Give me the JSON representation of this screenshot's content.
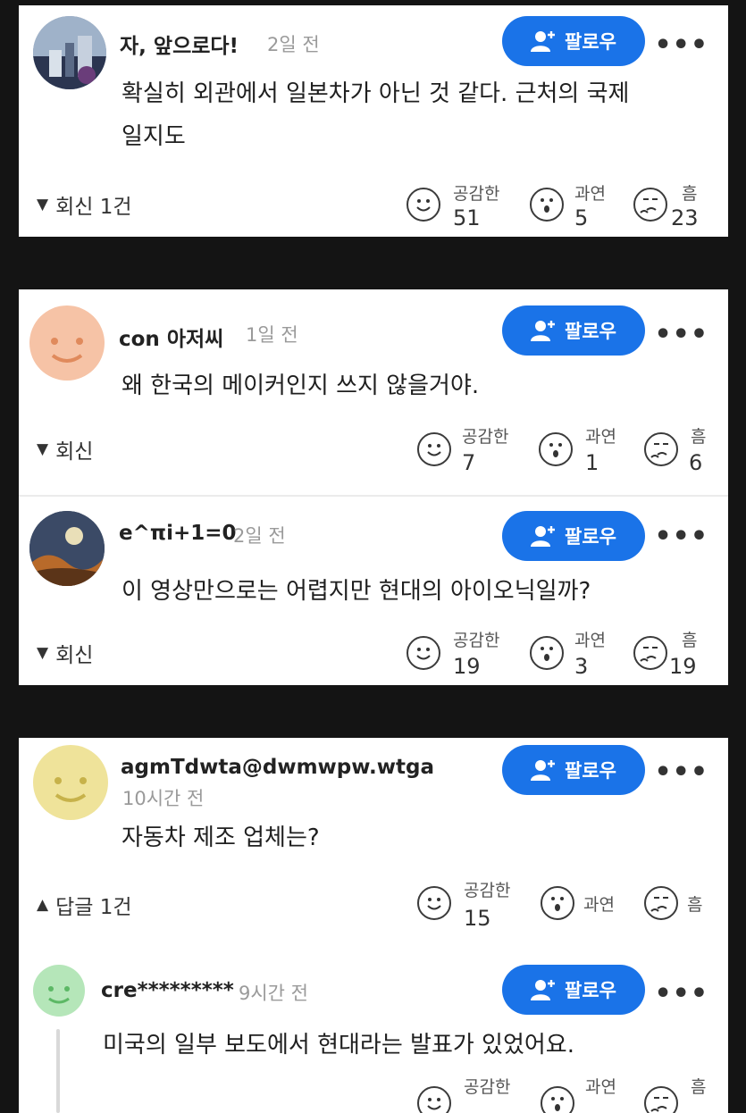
{
  "comments": [
    {
      "name": "자, 앞으로다!",
      "time": "2일 전",
      "text_line1": "확실히 외관에서 일본차가 아닌 것 같다. 근처의 국제",
      "text_line2": "일지도",
      "toggle": "회신 1건",
      "toggle_arrow": "▼",
      "reactions": [
        {
          "label": "공감한",
          "count": "51",
          "icon": "smile-face-icon"
        },
        {
          "label": "과연",
          "count": "5",
          "icon": "surprised-face-icon"
        },
        {
          "label": "흠",
          "count": "23",
          "icon": "thinking-face-icon"
        }
      ]
    },
    {
      "name": "con 아저씨",
      "time": "1일 전",
      "text": "왜 한국의 메이커인지 쓰지 않을거야.",
      "toggle": "회신",
      "toggle_arrow": "▼",
      "reactions": [
        {
          "label": "공감한",
          "count": "7",
          "icon": "smile-face-icon"
        },
        {
          "label": "과연",
          "count": "1",
          "icon": "surprised-face-icon"
        },
        {
          "label": "흠",
          "count": "6",
          "icon": "thinking-face-icon"
        }
      ]
    },
    {
      "name": "e^πi+1=0",
      "time": "2일 전",
      "text": "이 영상만으로는 어렵지만 현대의 아이오닉일까?",
      "toggle": "회신",
      "toggle_arrow": "▼",
      "reactions": [
        {
          "label": "공감한",
          "count": "19",
          "icon": "smile-face-icon"
        },
        {
          "label": "과연",
          "count": "3",
          "icon": "surprised-face-icon"
        },
        {
          "label": "흠",
          "count": "19",
          "icon": "thinking-face-icon"
        }
      ]
    },
    {
      "name": "agmTdwta@dwmwpw.wtga",
      "time": "10시간 전",
      "text": "자동차 제조 업체는?",
      "toggle": "답글 1건",
      "toggle_arrow": "▲",
      "reactions": [
        {
          "label": "공감한",
          "count": "15",
          "icon": "smile-face-icon"
        },
        {
          "label": "과연",
          "count": "",
          "icon": "surprised-face-icon"
        },
        {
          "label": "흠",
          "count": "",
          "icon": "thinking-face-icon"
        }
      ]
    },
    {
      "name": "cre*********",
      "time": "9시간 전",
      "text": "미국의 일부 보도에서 현대라는 발표가 있었어요.",
      "reactions": [
        {
          "label": "공감한",
          "count": "",
          "icon": "smile-face-icon"
        },
        {
          "label": "과연",
          "count": "",
          "icon": "surprised-face-icon"
        },
        {
          "label": "흠",
          "count": "",
          "icon": "thinking-face-icon"
        }
      ]
    }
  ],
  "follow_label": "팔로우",
  "more_label": "•••",
  "colors": {
    "follow_button": "#1a73e8",
    "background": "#141414",
    "card": "#ffffff"
  }
}
